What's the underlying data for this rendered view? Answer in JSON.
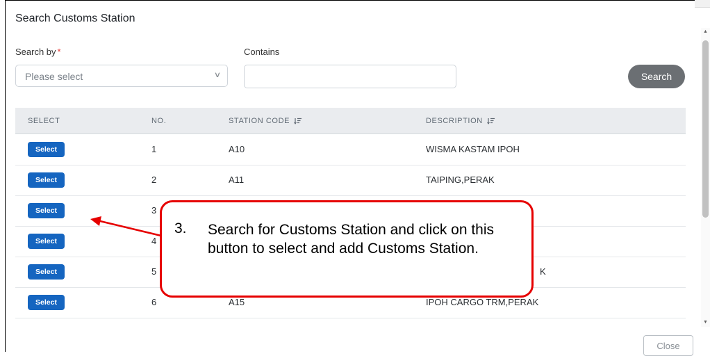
{
  "dialog": {
    "title": "Search Customs Station"
  },
  "search_form": {
    "search_by_label": "Search by",
    "required_mark": "*",
    "search_by_placeholder": "Please select",
    "contains_label": "Contains",
    "contains_value": "",
    "search_button": "Search"
  },
  "table": {
    "headers": [
      "SELECT",
      "NO.",
      "STATION CODE",
      "DESCRIPTION"
    ],
    "select_label": "Select",
    "rows": [
      {
        "no": "1",
        "code": "A10",
        "description": "WISMA KASTAM IPOH"
      },
      {
        "no": "2",
        "code": "A11",
        "description": "TAIPING,PERAK"
      },
      {
        "no": "3",
        "code": "",
        "description": ""
      },
      {
        "no": "4",
        "code": "",
        "description": ""
      },
      {
        "no": "5",
        "code": "",
        "description": "K"
      },
      {
        "no": "6",
        "code": "A15",
        "description": "IPOH CARGO TRM,PERAK"
      }
    ]
  },
  "close_button": "Close",
  "annotation": {
    "number": "3.",
    "text": "Search for Customs Station and click on this button to select and add Customs Station."
  },
  "colors": {
    "select_button": "#1565c0",
    "search_button": "#6b6f73",
    "annotation_border": "#e60000"
  }
}
